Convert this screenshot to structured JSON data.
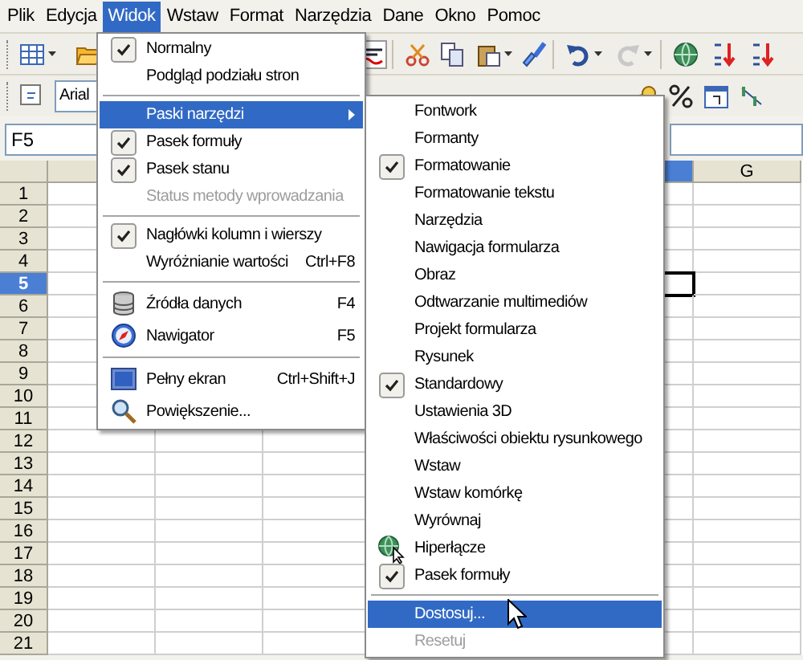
{
  "menu_bar": [
    {
      "label": "Plik",
      "selected": false
    },
    {
      "label": "Edycja",
      "selected": false
    },
    {
      "label": "Widok",
      "selected": true
    },
    {
      "label": "Wstaw",
      "selected": false
    },
    {
      "label": "Format",
      "selected": false
    },
    {
      "label": "Narzędzia",
      "selected": false
    },
    {
      "label": "Dane",
      "selected": false
    },
    {
      "label": "Okno",
      "selected": false
    },
    {
      "label": "Pomoc",
      "selected": false
    }
  ],
  "font_field": {
    "value": "Arial"
  },
  "name_box": {
    "value": "F5"
  },
  "column_headers": [
    {
      "selected": true
    },
    {
      "label": "G",
      "selected": false
    }
  ],
  "rows": [
    {
      "label": "1",
      "selected": false
    },
    {
      "label": "2",
      "selected": false
    },
    {
      "label": "3",
      "selected": false
    },
    {
      "label": "4",
      "selected": false
    },
    {
      "label": "5",
      "selected": true
    },
    {
      "label": "6",
      "selected": false
    },
    {
      "label": "7",
      "selected": false
    },
    {
      "label": "8",
      "selected": false
    },
    {
      "label": "9",
      "selected": false
    },
    {
      "label": "10",
      "selected": false
    },
    {
      "label": "11",
      "selected": false
    },
    {
      "label": "12",
      "selected": false
    },
    {
      "label": "13",
      "selected": false
    },
    {
      "label": "14",
      "selected": false
    },
    {
      "label": "15",
      "selected": false
    },
    {
      "label": "16",
      "selected": false
    },
    {
      "label": "17",
      "selected": false
    },
    {
      "label": "18",
      "selected": false
    },
    {
      "label": "19",
      "selected": false
    },
    {
      "label": "20",
      "selected": false
    },
    {
      "label": "21",
      "selected": false
    }
  ],
  "view_menu": [
    {
      "kind": "check",
      "label": "Normalny",
      "checked": true,
      "disabled": false,
      "selected": false
    },
    {
      "kind": "check",
      "label": "Podgląd podziału stron",
      "checked": false,
      "disabled": false,
      "selected": false
    },
    {
      "kind": "separator"
    },
    {
      "kind": "submenu",
      "label": "Paski narzędzi",
      "disabled": false,
      "selected": true
    },
    {
      "kind": "check",
      "label": "Pasek formuły",
      "checked": true,
      "disabled": false,
      "selected": false
    },
    {
      "kind": "check",
      "label": "Pasek stanu",
      "checked": true,
      "disabled": false,
      "selected": false
    },
    {
      "kind": "check",
      "label": "Status metody wprowadzania",
      "checked": false,
      "disabled": true,
      "selected": false
    },
    {
      "kind": "separator"
    },
    {
      "kind": "check",
      "label": "Nagłówki kolumn i wierszy",
      "checked": true,
      "disabled": false,
      "selected": false
    },
    {
      "kind": "check",
      "label": "Wyróżnianie wartości",
      "shortcut": "Ctrl+F8",
      "checked": false,
      "disabled": false,
      "selected": false
    },
    {
      "kind": "separator"
    },
    {
      "kind": "datasource",
      "label": "Źródła danych",
      "shortcut": "F4",
      "disabled": false,
      "selected": false
    },
    {
      "kind": "navigator",
      "label": "Nawigator",
      "shortcut": "F5",
      "disabled": false,
      "selected": false
    },
    {
      "kind": "separator"
    },
    {
      "kind": "fullscreen",
      "label": "Pełny ekran",
      "shortcut": "Ctrl+Shift+J",
      "disabled": false,
      "selected": false
    },
    {
      "kind": "zoom",
      "label": "Powiększenie...",
      "disabled": false,
      "selected": false
    }
  ],
  "toolbars_submenu": [
    {
      "kind": "check",
      "label": "Fontwork",
      "checked": false,
      "disabled": false,
      "selected": false
    },
    {
      "kind": "check",
      "label": "Formanty",
      "checked": false,
      "disabled": false,
      "selected": false
    },
    {
      "kind": "check",
      "label": "Formatowanie",
      "checked": true,
      "disabled": false,
      "selected": false
    },
    {
      "kind": "check",
      "label": "Formatowanie tekstu",
      "checked": false,
      "disabled": false,
      "selected": false
    },
    {
      "kind": "check",
      "label": "Narzędzia",
      "checked": false,
      "disabled": false,
      "selected": false
    },
    {
      "kind": "check",
      "label": "Nawigacja formularza",
      "checked": false,
      "disabled": false,
      "selected": false
    },
    {
      "kind": "check",
      "label": "Obraz",
      "checked": false,
      "disabled": false,
      "selected": false
    },
    {
      "kind": "check",
      "label": "Odtwarzanie multimediów",
      "checked": false,
      "disabled": false,
      "selected": false
    },
    {
      "kind": "check",
      "label": "Projekt formularza",
      "checked": false,
      "disabled": false,
      "selected": false
    },
    {
      "kind": "check",
      "label": "Rysunek",
      "checked": false,
      "disabled": false,
      "selected": false
    },
    {
      "kind": "check",
      "label": "Standardowy",
      "checked": true,
      "disabled": false,
      "selected": false
    },
    {
      "kind": "check",
      "label": "Ustawienia 3D",
      "checked": false,
      "disabled": false,
      "selected": false
    },
    {
      "kind": "check",
      "label": "Właściwości obiektu rysunkowego",
      "checked": false,
      "disabled": false,
      "selected": false
    },
    {
      "kind": "check",
      "label": "Wstaw",
      "checked": false,
      "disabled": false,
      "selected": false
    },
    {
      "kind": "check",
      "label": "Wstaw komórkę",
      "checked": false,
      "disabled": false,
      "selected": false
    },
    {
      "kind": "check",
      "label": "Wyrównaj",
      "checked": false,
      "disabled": false,
      "selected": false
    },
    {
      "kind": "hyperlink",
      "label": "Hiperłącze",
      "disabled": false,
      "selected": false
    },
    {
      "kind": "check",
      "label": "Pasek formuły",
      "checked": true,
      "disabled": false,
      "selected": false
    },
    {
      "kind": "separator"
    },
    {
      "kind": "plain",
      "label": "Dostosuj...",
      "disabled": false,
      "selected": true
    },
    {
      "kind": "plain",
      "label": "Resetuj",
      "disabled": true,
      "selected": false
    }
  ]
}
